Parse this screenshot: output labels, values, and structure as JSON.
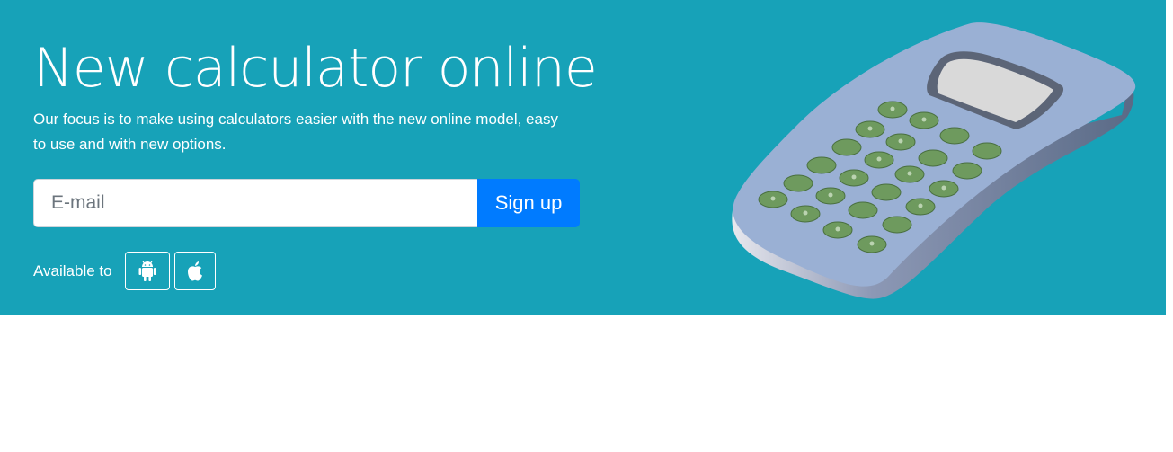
{
  "hero": {
    "title": "New calculator online",
    "lead": "Our focus is to make using calculators easier with the new online model, easy to use and with new options.",
    "background_color": "#17a2b8"
  },
  "signup": {
    "email_placeholder": "E-mail",
    "email_value": "",
    "button_label": "Sign up",
    "button_color": "#007bff"
  },
  "availability": {
    "label": "Available to",
    "platforms": [
      {
        "name": "android",
        "icon": "android-icon"
      },
      {
        "name": "apple",
        "icon": "apple-icon"
      }
    ]
  },
  "illustration": {
    "icon": "calculator-illustration",
    "body_color": "#9ab0d4",
    "key_color": "#6e9a5e",
    "screen_color": "#d9d9d9"
  }
}
